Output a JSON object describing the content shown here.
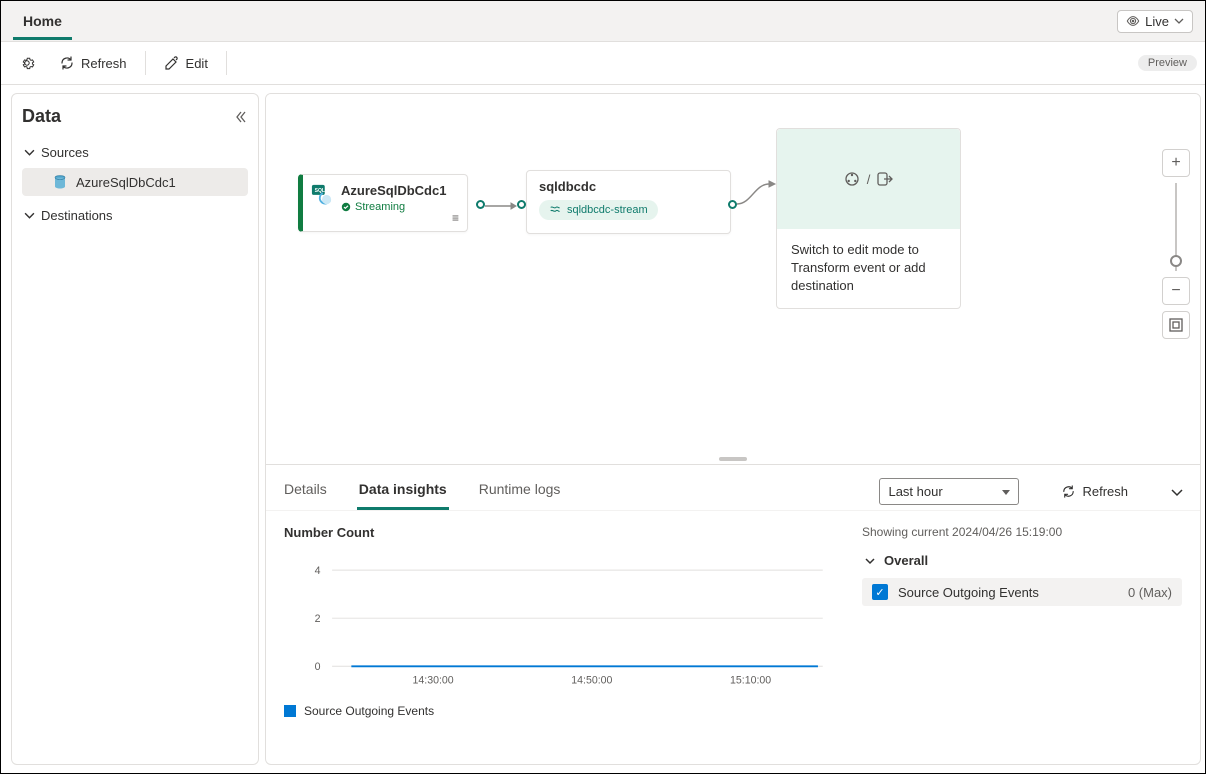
{
  "topnav": {
    "tab": "Home",
    "live_label": "Live"
  },
  "toolbar": {
    "refresh": "Refresh",
    "edit": "Edit",
    "preview": "Preview"
  },
  "sidebar": {
    "title": "Data",
    "sources_header": "Sources",
    "destinations_header": "Destinations",
    "source_item": "AzureSqlDbCdc1"
  },
  "canvas": {
    "source_node": {
      "title": "AzureSqlDbCdc1",
      "status": "Streaming"
    },
    "stream_node": {
      "title": "sqldbcdc",
      "pill": "sqldbcdc-stream"
    },
    "dest_node": {
      "text": "Switch to edit mode to Transform event or add destination"
    }
  },
  "bottom": {
    "tab_details": "Details",
    "tab_insights": "Data insights",
    "tab_runtime": "Runtime logs",
    "time_range": "Last hour",
    "refresh": "Refresh",
    "chart_title": "Number Count",
    "showing": "Showing current 2024/04/26 15:19:00",
    "overall": "Overall",
    "metric_label": "Source Outgoing Events",
    "metric_value": "0 (Max)",
    "legend": "Source Outgoing Events"
  },
  "chart_data": {
    "type": "line",
    "title": "Number Count",
    "xlabel": "",
    "ylabel": "",
    "ylim": [
      0,
      4
    ],
    "x_ticks": [
      "14:30:00",
      "14:50:00",
      "15:10:00"
    ],
    "y_ticks": [
      0,
      2,
      4
    ],
    "series": [
      {
        "name": "Source Outgoing Events",
        "color": "#0078d4",
        "x": [
          "14:20:00",
          "14:30:00",
          "14:40:00",
          "14:50:00",
          "15:00:00",
          "15:10:00",
          "15:19:00"
        ],
        "values": [
          0,
          0,
          0,
          0,
          0,
          0,
          0
        ]
      }
    ]
  }
}
